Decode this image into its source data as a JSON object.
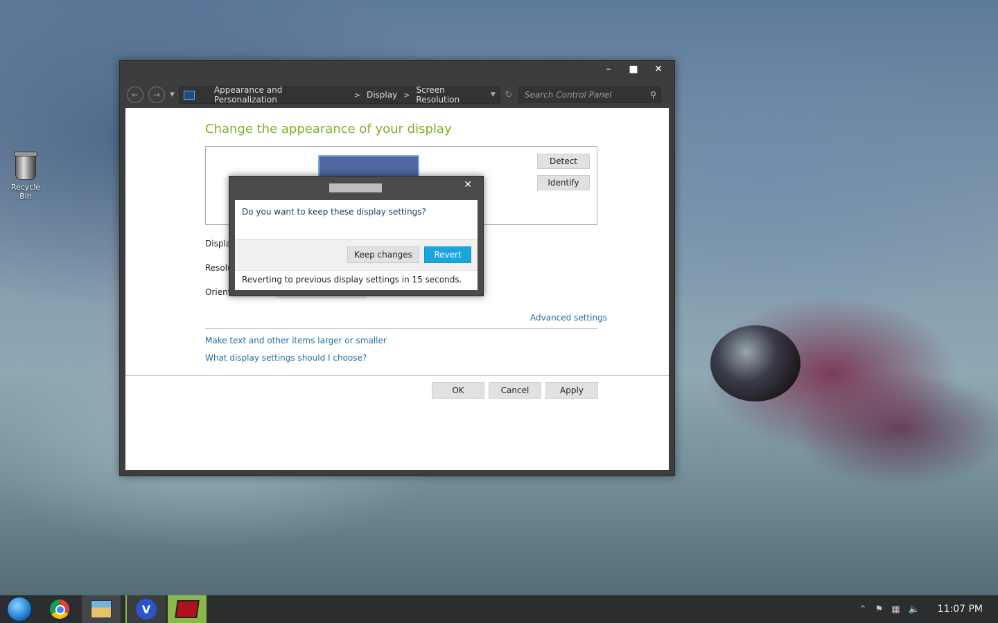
{
  "desktop": {
    "recycle_bin_label": "Recycle Bin"
  },
  "window": {
    "controls": {
      "minimize": "–",
      "maximize": "■",
      "close": "✕"
    },
    "breadcrumb": [
      "Appearance and Personalization",
      "Display",
      "Screen Resolution"
    ],
    "breadcrumb_separator": ">",
    "search_placeholder": "Search Control Panel",
    "heading": "Change the appearance of your display",
    "detect_label": "Detect",
    "identify_label": "Identify",
    "display_label": "Display",
    "resolution_label": "Resolu",
    "orientation_label": "Orienta",
    "advanced_settings": "Advanced settings",
    "links": [
      "Make text and other items larger or smaller",
      "What display settings should I choose?"
    ],
    "ok_label": "OK",
    "cancel_label": "Cancel",
    "apply_label": "Apply"
  },
  "dialog": {
    "question": "Do you want to keep these display settings?",
    "keep_label": "Keep changes",
    "revert_label": "Revert",
    "status": "Reverting to previous display settings in 15 seconds.",
    "close": "✕"
  },
  "taskbar": {
    "clock": "11:07 PM",
    "v_app_letter": "V",
    "tray_icons": [
      "chevron-up-icon",
      "action-center-flag-icon",
      "network-icon",
      "volume-icon"
    ]
  },
  "colors": {
    "accent_green": "#7fae24",
    "link_blue": "#1d6fa8",
    "revert_blue": "#1aa6dc"
  }
}
